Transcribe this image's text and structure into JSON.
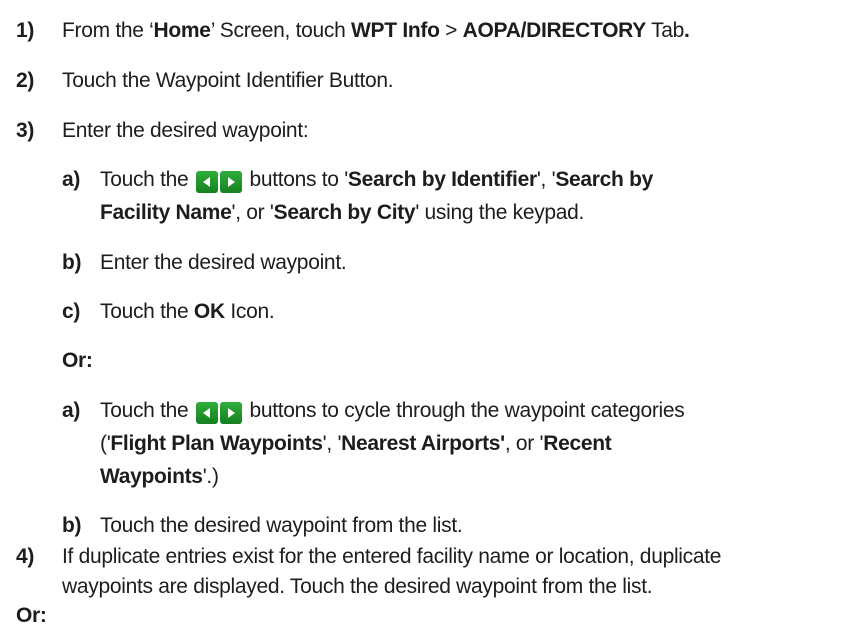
{
  "steps": [
    {
      "num": "1)",
      "parts": [
        "From the ‘",
        "Home",
        "’ Screen, touch ",
        "WPT Info",
        " > ",
        "AOPA/DIRECTORY",
        " Tab",
        "."
      ]
    },
    {
      "num": "2)",
      "text": "Touch the Waypoint Identifier Button."
    },
    {
      "num": "3)",
      "text": "Enter the desired waypoint:"
    }
  ],
  "sub_a1": {
    "num": "a)",
    "line1": [
      "Touch the ",
      " buttons to '",
      "Search by Identifier",
      "', '",
      "Search by"
    ],
    "line2": [
      "Facility Name",
      "', or '",
      "Search by City",
      "' using the keypad."
    ]
  },
  "sub_b1": {
    "num": "b)",
    "text": "Enter the desired waypoint."
  },
  "sub_c1": {
    "num": "c)",
    "parts": [
      "Touch the ",
      "OK",
      " Icon."
    ]
  },
  "or1": "Or:",
  "sub_a2": {
    "num": "a)",
    "line1": [
      "Touch the ",
      " buttons to cycle through the waypoint categories"
    ],
    "line2": [
      "('",
      "Flight Plan Waypoints",
      "', '",
      "Nearest Airports'",
      ", or '",
      "Recent"
    ],
    "line3": [
      "Waypoints",
      "'.)"
    ]
  },
  "sub_b2": {
    "num": "b)",
    "text": "Touch the desired waypoint from the list."
  },
  "step4": {
    "num": "4)",
    "line1": "If duplicate entries exist for the entered facility name or location, duplicate",
    "line2": "waypoints are displayed.  Touch the desired waypoint from the list."
  },
  "or2": "Or:",
  "icons": {
    "left": "left-arrow-icon",
    "right": "right-arrow-icon",
    "accent": "#1f9a2b"
  }
}
